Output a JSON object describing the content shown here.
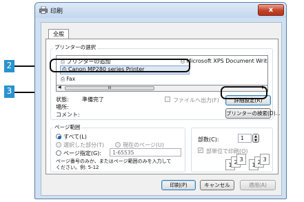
{
  "window": {
    "title": "印刷",
    "close_label": "x"
  },
  "tab": {
    "label": "全般"
  },
  "printer_select": {
    "group_title": "プリンターの選択",
    "items": [
      {
        "label": "プリンターの追加"
      },
      {
        "label": "Microsoft XPS Document Writ"
      },
      {
        "label": "Canon MP280 series Printer",
        "selected": true
      },
      {
        "label": "Fax"
      }
    ],
    "scroll_marker": "III",
    "status_label": "状態:",
    "status_value": "準備完了",
    "location_label": "場所:",
    "comment_label": "コメント:",
    "print_to_file_label": "ファイルへ出力(F)",
    "preferences_button": "詳細設定(R)",
    "find_printer_button": "プリンターの検索(D)..."
  },
  "page_range": {
    "group_title": "ページ範囲",
    "all_label": "すべて(L)",
    "selection_label": "選択した部分(T)",
    "current_page_label": "現在のページ(U)",
    "pages_label": "ページ指定(G):",
    "pages_value": "1-65535",
    "hint_line1": "ページ番号のみか、またはページ範囲のみを入力して",
    "hint_line2": "ください。例: 5-12"
  },
  "copies": {
    "label": "部数(C):",
    "value": "1",
    "collate_label": "部単位で印刷(O)",
    "collate_icons": [
      "1",
      "2",
      "3",
      "1",
      "2",
      "3"
    ]
  },
  "footer": {
    "print_button": "印刷(P)",
    "cancel_button": "キャンセル",
    "apply_button": "適用(A)"
  },
  "callouts": [
    "2",
    "3"
  ],
  "colors": {
    "callout": "#2a93cf",
    "titlebar": "#c3d7ee",
    "close": "#c3432a"
  }
}
